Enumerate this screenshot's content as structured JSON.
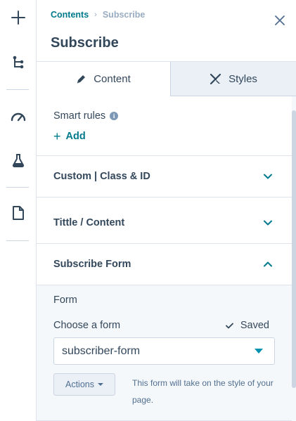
{
  "colors": {
    "accent": "#007a8c",
    "text": "#33475b",
    "muted": "#99acc2",
    "panel_bg": "#f5f8fa",
    "border": "#dfe3eb"
  },
  "rail": {
    "icons": [
      "plus-icon",
      "tree-structure-icon",
      "gauge-icon",
      "flask-icon",
      "document-icon"
    ]
  },
  "breadcrumb": {
    "parent": "Contents",
    "separator": "›",
    "current": "Subscribe"
  },
  "panel": {
    "title": "Subscribe"
  },
  "tabs": [
    {
      "label": "Content",
      "icon": "pencil-icon",
      "active": true
    },
    {
      "label": "Styles",
      "icon": "brush-icon",
      "active": false
    }
  ],
  "smart_rules": {
    "label": "Smart rules",
    "info_icon": "i",
    "add_label": "Add",
    "add_symbol": "+"
  },
  "sections": [
    {
      "label": "Custom | Class & ID",
      "expanded": false
    },
    {
      "label": "Tittle / Content",
      "expanded": false
    },
    {
      "label": "Subscribe Form",
      "expanded": true
    }
  ],
  "form": {
    "form_label": "Form",
    "choose_label": "Choose a form",
    "saved_label": "Saved",
    "selected_form": "subscriber-form",
    "actions_label": "Actions",
    "hint": "This form will take on the style of your page."
  }
}
